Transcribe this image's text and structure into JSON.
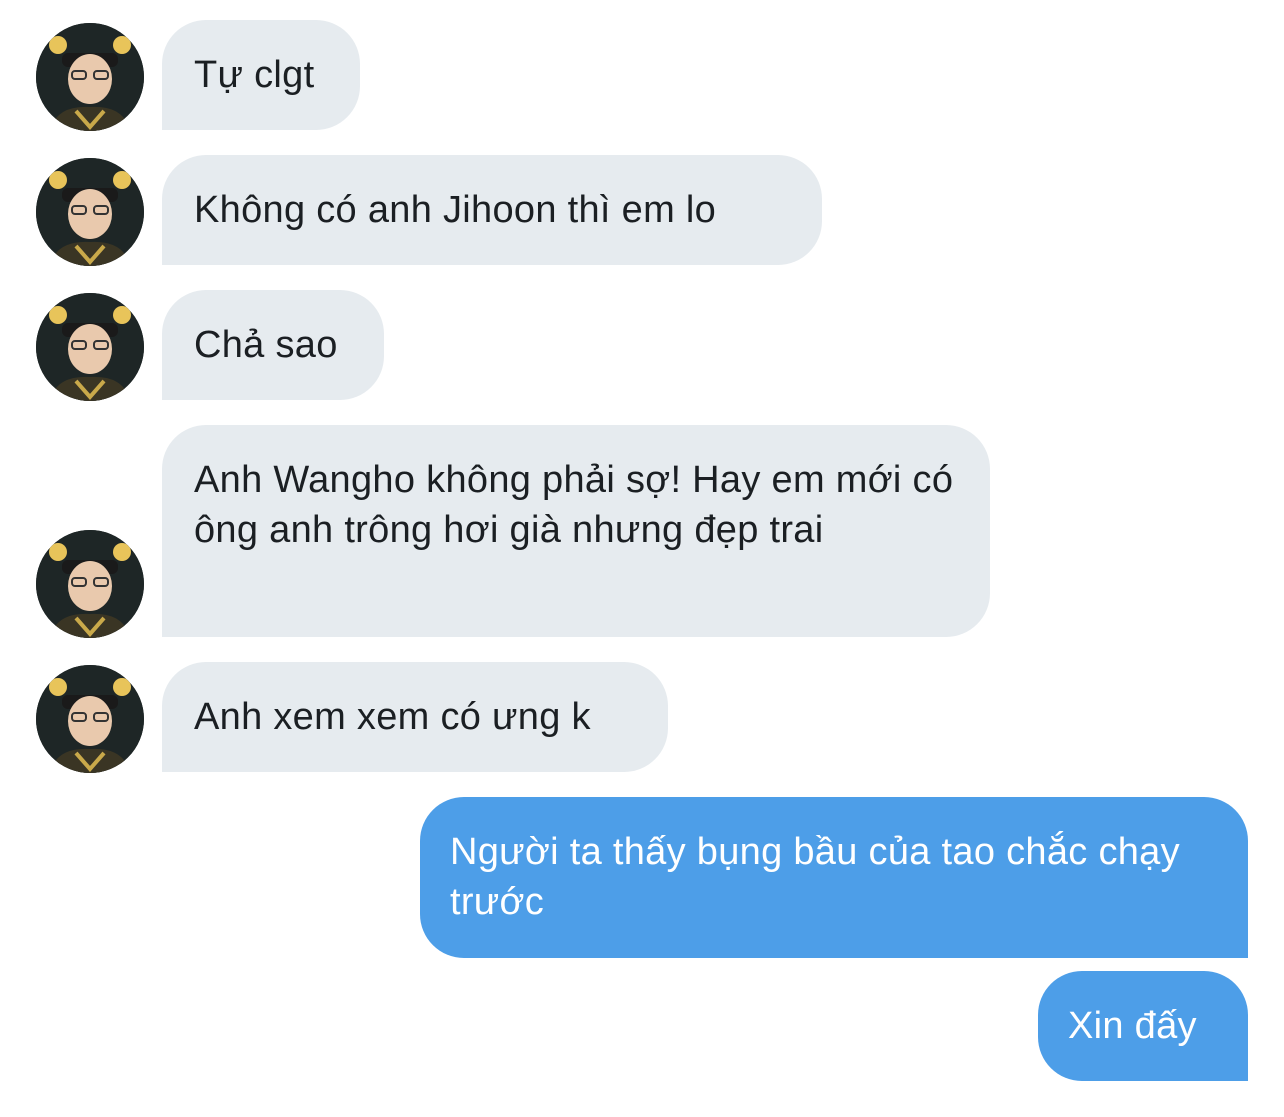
{
  "conversation": {
    "accent_color": "#4d9ee8",
    "incoming_bubble_color": "#e6ebef",
    "messages": [
      {
        "sender": "other",
        "text": "Tự clgt"
      },
      {
        "sender": "other",
        "text": "Không có anh Jihoon thì em lo"
      },
      {
        "sender": "other",
        "text": "Chả sao"
      },
      {
        "sender": "other",
        "text": "Anh Wangho không phải sợ! Hay em mới có ông anh trông hơi già nhưng đẹp trai"
      },
      {
        "sender": "other",
        "text": "Anh xem xem có ưng k"
      },
      {
        "sender": "me",
        "text": "Người ta thấy bụng bầu của tao chắc chạy trước"
      },
      {
        "sender": "me",
        "text": "Xin đấy"
      }
    ]
  }
}
